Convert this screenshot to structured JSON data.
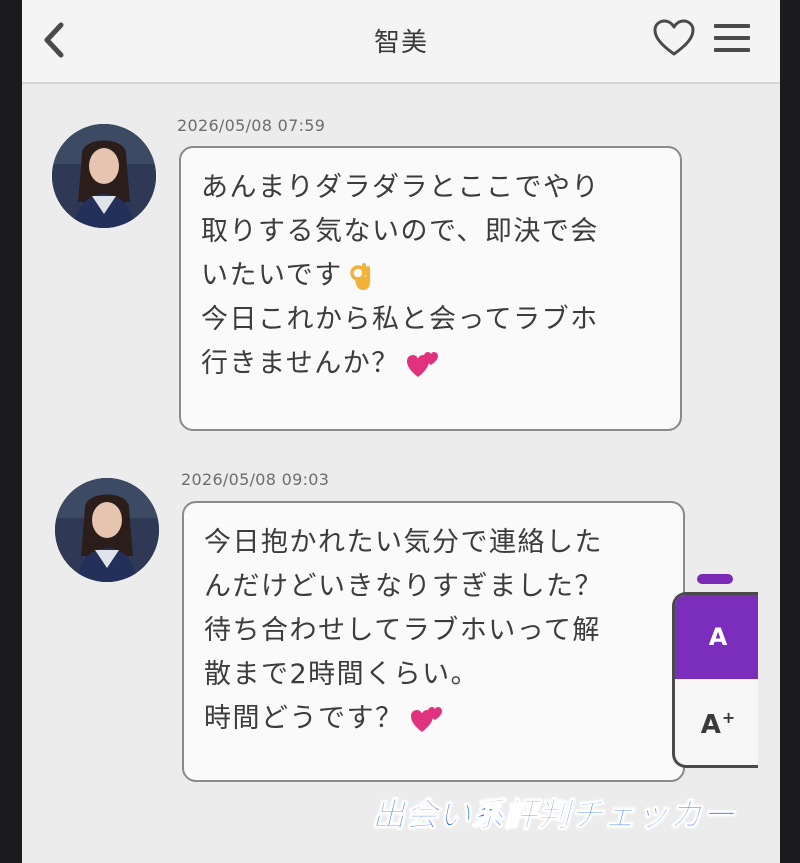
{
  "header": {
    "title": "智美",
    "icons": [
      "chevron-left-icon",
      "heart-icon",
      "menu-icon"
    ]
  },
  "messages": [
    {
      "timestamp": "2026/05/08 07:59",
      "lines": [
        "あんまりダラダラとここでやり",
        "取りする気ないので、即決で会",
        "いたいです",
        "今日これから私と会ってラブホ",
        "行きませんか？"
      ],
      "emojis": [
        "ok-hand-emoji",
        "two-hearts-emoji"
      ]
    },
    {
      "timestamp": "2026/05/08 09:03",
      "lines": [
        "今日抱かれたい気分で連絡した",
        "んだけどいきなりすぎました？",
        "待ち合わせしてラブホいって解",
        "散まで2時間くらい。",
        "時間どうです？"
      ],
      "emojis": [
        "two-hearts-emoji"
      ]
    }
  ],
  "font_size_panel": {
    "small_label": "A",
    "large_label": "A",
    "large_suffix": "+",
    "selected": "A",
    "accent_color": "#7b2dbb"
  },
  "watermark": {
    "text": "出会い系評判チェッカー",
    "color": "#2a6cf0"
  }
}
